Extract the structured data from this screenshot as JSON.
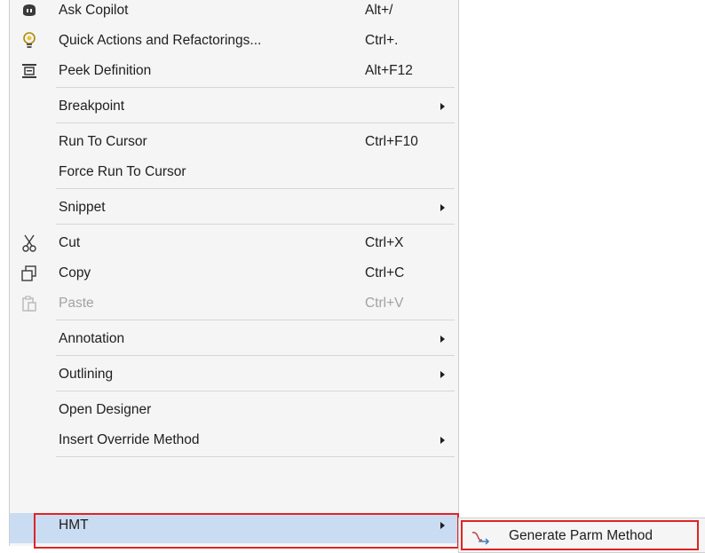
{
  "menu": {
    "items": [
      {
        "label": "Ask Copilot",
        "shortcut": "Alt+/",
        "icon": "copilot-icon"
      },
      {
        "label": "Quick Actions and Refactorings...",
        "shortcut": "Ctrl+.",
        "icon": "lightbulb-icon"
      },
      {
        "label": "Peek Definition",
        "shortcut": "Alt+F12",
        "icon": "peek-definition-icon"
      },
      {
        "label": "Breakpoint",
        "shortcut": ""
      },
      {
        "label": "Run To Cursor",
        "shortcut": "Ctrl+F10"
      },
      {
        "label": "Force Run To Cursor",
        "shortcut": ""
      },
      {
        "label": "Snippet",
        "shortcut": ""
      },
      {
        "label": "Cut",
        "shortcut": "Ctrl+X",
        "icon": "scissors-icon"
      },
      {
        "label": "Copy",
        "shortcut": "Ctrl+C",
        "icon": "copy-icon"
      },
      {
        "label": "Paste",
        "shortcut": "Ctrl+V",
        "icon": "paste-icon",
        "disabled": true
      },
      {
        "label": "Annotation",
        "shortcut": ""
      },
      {
        "label": "Outlining",
        "shortcut": ""
      },
      {
        "label": "Open Designer",
        "shortcut": ""
      },
      {
        "label": "Insert Override Method",
        "shortcut": ""
      },
      {
        "label": "HMT",
        "shortcut": "",
        "highlighted": true
      }
    ]
  },
  "submenu": {
    "items": [
      {
        "label": "Generate Parm Method",
        "icon": "method-icon"
      }
    ]
  },
  "colors": {
    "menu_background": "#f5f5f5",
    "highlight": "#c9dcf2",
    "annotation_box": "#e02424",
    "disabled_text": "#a2a2a2"
  }
}
